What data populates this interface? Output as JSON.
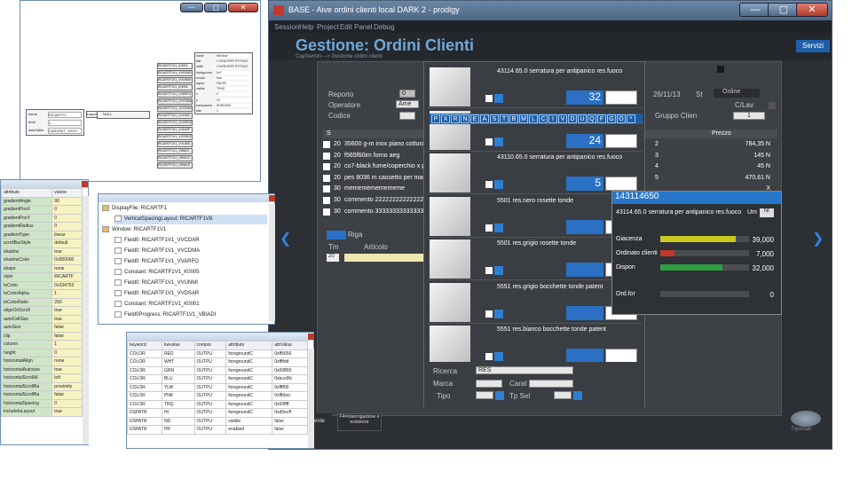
{
  "app": {
    "title": "BASE - Aive ordini clienti local DARK 2 - prodigy",
    "min_glyph": "—",
    "max_glyph": "▢",
    "close_glyph": "✕",
    "menu": [
      "Session",
      "Help",
      "Project",
      "Edit",
      "Panel",
      "Debug"
    ],
    "page_title": "Gestione: Ordini Clienti",
    "breadcrumb": "CayGemini --> Gestione ordini clienti",
    "servizi": "Servizi"
  },
  "form": {
    "reporto": "Reporto",
    "reporto_val": "0",
    "operatore": "Operatore",
    "operatore_val": "Ame",
    "codice": "Codice",
    "date": "26/11/13",
    "st": "St",
    "online": "Online",
    "clav": "C/Lav",
    "gruppo": "Gruppo Clien",
    "gruppo_val": "1",
    "prezzo": "Prezzo",
    "s_col": "S",
    "riga": "Riga",
    "tm": "Tm",
    "articolo": "Articolo",
    "tm_val": "20",
    "bottom_btn1": "erde",
    "bottom_btn2": "F4=Interrogazione e esistenze"
  },
  "rows": [
    {
      "q": "20",
      "desc": "35600 g-m inox piano cottura"
    },
    {
      "q": "20",
      "desc": "f565f60im forno aeg"
    },
    {
      "q": "20",
      "desc": "co7-black fume/coperchio x p"
    },
    {
      "q": "20",
      "desc": "pes 8036 m cassetto per mac"
    },
    {
      "q": "30",
      "desc": "mememememememe"
    },
    {
      "q": "30",
      "desc": "commento 222222222222222"
    },
    {
      "q": "30",
      "desc": "commento 33333333333333"
    }
  ],
  "right_rows": [
    {
      "n": "2",
      "p": "784,35 N"
    },
    {
      "n": "3",
      "p": "145 N"
    },
    {
      "n": "4",
      "p": "45 N"
    },
    {
      "n": "5",
      "p": "470,61 N"
    },
    {
      "n": "",
      "p": "X"
    }
  ],
  "alphabet": [
    "P",
    "X",
    "R",
    "N",
    "E",
    "A",
    "S",
    "T",
    "B",
    "M",
    "L",
    "C",
    "I",
    "V",
    "D",
    "U",
    "Q",
    "F",
    "G",
    "O",
    "*"
  ],
  "items": [
    {
      "title": "43114.65.0 serratura per antipanico res.fuoco",
      "qty": "32"
    },
    {
      "title": "",
      "qty": "24"
    },
    {
      "title": "43110.65.0 serratura per antipanico res.fuoco",
      "qty": "5"
    },
    {
      "title": "5501 res.nero rosette tonde",
      "qty": ""
    },
    {
      "title": "5501 res.grigio rosette tonde",
      "qty": ""
    },
    {
      "title": "5551 res.grigio bocchette tonde patent",
      "qty": ""
    },
    {
      "title": "5551 res.bianco bocchette tonde patent",
      "qty": ""
    }
  ],
  "search": {
    "ricerca": "Ricerca",
    "ricerca_val": "RES",
    "marca": "Marca",
    "carat": "Carat",
    "tipo": "Tipo",
    "tpsel": "Tp Sel"
  },
  "detail": {
    "code": "143114650",
    "desc": "43114.65.0 serratura per antipanico res.fuoco",
    "um": "Um",
    "um_val": "Nr",
    "rows": [
      {
        "label": "Giacenza",
        "value": "39,000",
        "fill": 0.85,
        "color": "#c8c81e"
      },
      {
        "label": "Ordinato clienti",
        "value": "7,000",
        "fill": 0.16,
        "color": "#c0392b"
      },
      {
        "label": "Dispon",
        "value": "32,000",
        "fill": 0.7,
        "color": "#2e9e3e"
      },
      {
        "label": "Ord.for",
        "value": "0",
        "fill": 0,
        "color": "#888"
      }
    ]
  },
  "props": {
    "header": [
      "attributo",
      "valore"
    ],
    "rows": [
      [
        "gradientAngle",
        "90"
      ],
      [
        "gradientPosX",
        "0"
      ],
      [
        "gradientPosY",
        "0"
      ],
      [
        "gradientRadius",
        "0"
      ],
      [
        "gradientType",
        "linear"
      ],
      [
        "scrollBarStyle",
        "default"
      ],
      [
        "shadow",
        "true"
      ],
      [
        "shadowColor",
        "0x000000"
      ],
      [
        "shape",
        "none"
      ],
      [
        "style",
        "RICARTF"
      ],
      [
        "toColor",
        "0x334753"
      ],
      [
        "toColorAlpha",
        "1"
      ],
      [
        "toColorRatio",
        "250"
      ],
      [
        "alignOnScroll",
        "true"
      ],
      [
        "autoCellSize",
        "true"
      ],
      [
        "autoSize",
        "false"
      ],
      [
        "clip",
        "false"
      ],
      [
        "column",
        "1"
      ],
      [
        "height",
        "0"
      ],
      [
        "horizontalAlign",
        "none"
      ],
      [
        "horizontalAutosize",
        "true"
      ],
      [
        "horizontalScrollAl",
        "left"
      ],
      [
        "horizontalScrollBa",
        "proximity"
      ],
      [
        "horizontalScrollBa",
        "false"
      ],
      [
        "horizontalSpacing",
        "0"
      ],
      [
        "includeInLayout",
        "true"
      ]
    ]
  },
  "tree": {
    "items": [
      {
        "t": "DisplayFile: RICARTF1",
        "d": 0
      },
      {
        "t": "VerticalSpacingLayout: RICARTF1V8",
        "d": 1
      },
      {
        "t": "Window: RICARTF1V1",
        "d": 0
      },
      {
        "t": "Field0: RICARTF1V1_VVCDAR",
        "d": 1
      },
      {
        "t": "Field0: RICARTF1V1_VVCDMA",
        "d": 1
      },
      {
        "t": "Field0: RICARTF1V1_VVARFO",
        "d": 1
      },
      {
        "t": "Constant: RICARTF1V1_K0005",
        "d": 1
      },
      {
        "t": "Field0: RICARTF1V1_VVUNMI",
        "d": 1
      },
      {
        "t": "Field0: RICARTF1V1_VVDSAR",
        "d": 1
      },
      {
        "t": "Constant: RICARTF1V1_K0001",
        "d": 1
      },
      {
        "t": "Field0Progress: RICARTF1V1_VBIADI",
        "d": 1
      }
    ]
  },
  "kw": {
    "header": [
      "keyword",
      "kwvalue",
      "compor",
      "attributo",
      "attrValue"
    ],
    "rows": [
      [
        "COLOR",
        "RED",
        "OUTPU",
        "foregroundC",
        "0xff5656"
      ],
      [
        "COLOR",
        "WHT",
        "OUTPU",
        "foregroundC",
        "0xffffdd"
      ],
      [
        "COLOR",
        "GRN",
        "OUTPU",
        "foregroundC",
        "0x00ff00"
      ],
      [
        "COLOR",
        "BLU",
        "OUTPU",
        "foregroundC",
        "0xbce9fc"
      ],
      [
        "COLOR",
        "YLW",
        "OUTPU",
        "foregroundC",
        "0xffff00"
      ],
      [
        "COLOR",
        "PNK",
        "OUTPU",
        "foregroundC",
        "0xffbbcc"
      ],
      [
        "COLOR",
        "TRQ",
        "OUTPU",
        "foregroundC",
        "0x00ffff"
      ],
      [
        "DSPATR",
        "HI",
        "OUTPU",
        "foregroundC",
        "0xd5ecff"
      ],
      [
        "DSPATR",
        "ND",
        "OUTPU",
        "visible",
        "false"
      ],
      [
        "DSPATR",
        "PR",
        "OUTPU",
        "enabled",
        "false"
      ]
    ]
  },
  "diagram": {
    "left_fields": [
      [
        "name",
        "RICARTF1"
      ],
      [
        "level",
        "1"
      ],
      [
        "dataTable",
        "CARDSET_XXXX"
      ]
    ],
    "mid": "Layout",
    "mid_val": "NULL",
    "nodes": [
      "RICARTF1V1_K0001",
      "RICARTF1V1_VVDSAR",
      "RICARTF1V1_VVUNMI",
      "RICARTF1V1_K0005",
      "RICARTF1V1_VVARFO",
      "RICARTF1V1_VVCDMA",
      "RICARTF1V1_VVCDAR",
      "RICARTF1V1_VVGIAC",
      "RICARTF1V1_VVORDC",
      "RICARTF1V1_VVDISP",
      "RICARTF1V1_VVORDF",
      "RICARTF1V1_VVLIMG",
      "RICARTF1V1_VBIADI",
      "RICARTF1V1_VBIAOC",
      "RICARTF1V1_VBIADS"
    ],
    "props": [
      [
        "name",
        "Window"
      ],
      [
        "title",
        "CSH3D/FRR RTF0002"
      ],
      [
        "width",
        "CSH3D/FRR RTF0002"
      ],
      [
        "background",
        "0x7"
      ],
      [
        "modal",
        "true"
      ],
      [
        "layout",
        "FALSE"
      ],
      [
        "visible",
        "TRUE"
      ],
      [
        "x",
        "0"
      ],
      [
        "y",
        "10"
      ],
      [
        "transparent",
        "SHADOW"
      ],
      [
        "skin",
        "1"
      ]
    ]
  },
  "taskbar": {
    "label": "Tryorsan"
  }
}
